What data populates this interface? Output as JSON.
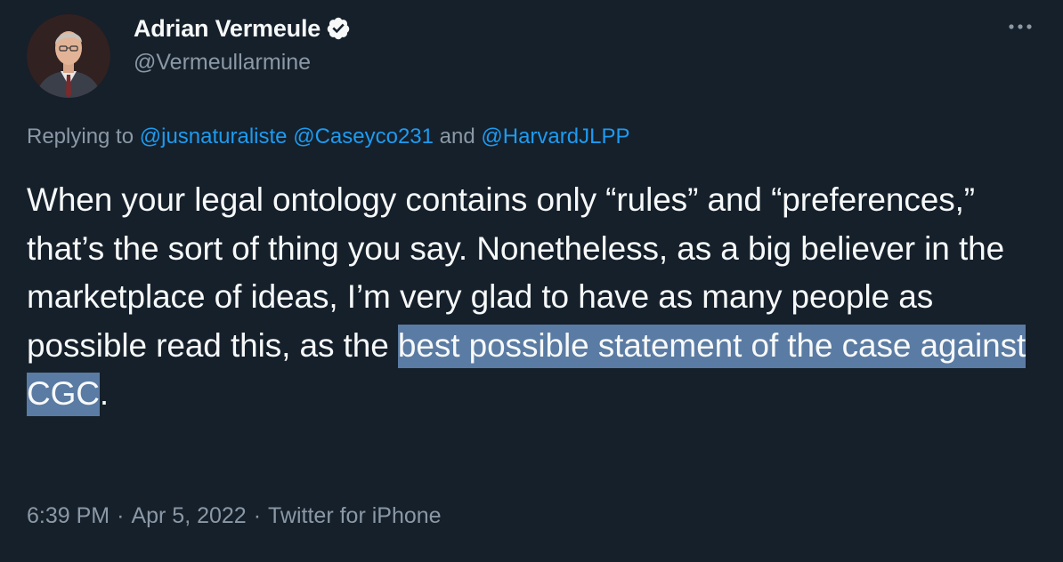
{
  "author": {
    "display_name": "Adrian Vermeule",
    "handle": "@Vermeullarmine",
    "verified": true
  },
  "reply": {
    "prefix": "Replying to",
    "mentions": [
      "@jusnaturaliste",
      "@Caseyco231",
      "@HarvardJLPP"
    ],
    "connector": "and"
  },
  "tweet": {
    "text_before": "When your legal ontology contains only “rules” and “preferences,” that’s the sort of thing you say. Nonetheless, as a big believer in the marketplace of ideas, I’m very glad to have as many people as possible read this, as the ",
    "text_highlighted": "best possible statement of the case against CGC",
    "text_after": "."
  },
  "meta": {
    "time": "6:39 PM",
    "date": "Apr 5, 2022",
    "source": "Twitter for iPhone",
    "separator": "·"
  },
  "icons": {
    "verified": "verified-badge-icon",
    "more": "more-horizontal-icon"
  },
  "colors": {
    "background": "#15202b",
    "primary_text": "#f7f9f9",
    "secondary_text": "#8b98a5",
    "link": "#1d9bf0",
    "highlight": "#5a7ba3"
  }
}
